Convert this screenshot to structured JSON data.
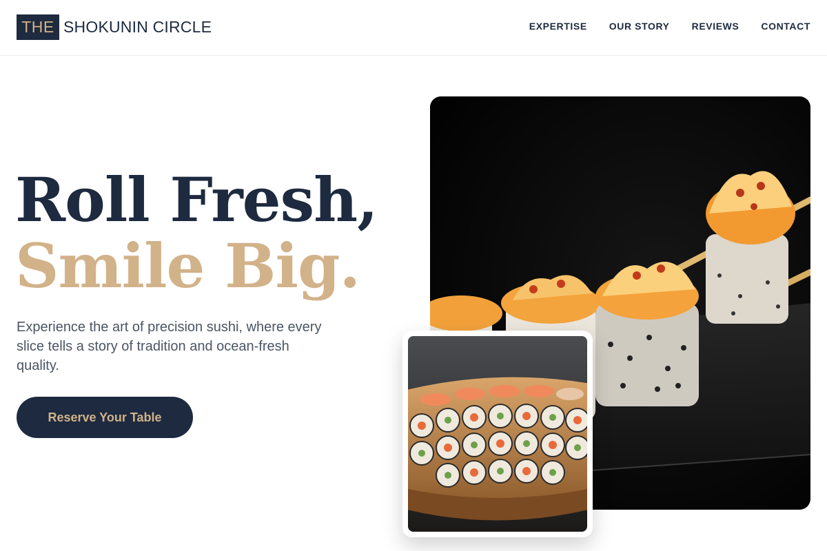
{
  "brand": {
    "badge": "THE",
    "name": "SHOKUNIN CIRCLE"
  },
  "nav": [
    {
      "label": "EXPERTISE"
    },
    {
      "label": "OUR STORY"
    },
    {
      "label": "REVIEWS"
    },
    {
      "label": "CONTACT"
    }
  ],
  "hero": {
    "headline_line1": "Roll Fresh,",
    "headline_line2": "Smile Big.",
    "subtitle": "Experience the art of precision sushi, where every slice tells a story of tradition and ocean-fresh quality.",
    "cta_label": "Reserve Your Table"
  },
  "colors": {
    "navy": "#1d2a3f",
    "gold": "#d2b289",
    "text_gray": "#4b5563"
  },
  "images": {
    "main": "sushi-rolls-photo",
    "inset": "sushi-boat-platter-photo"
  }
}
